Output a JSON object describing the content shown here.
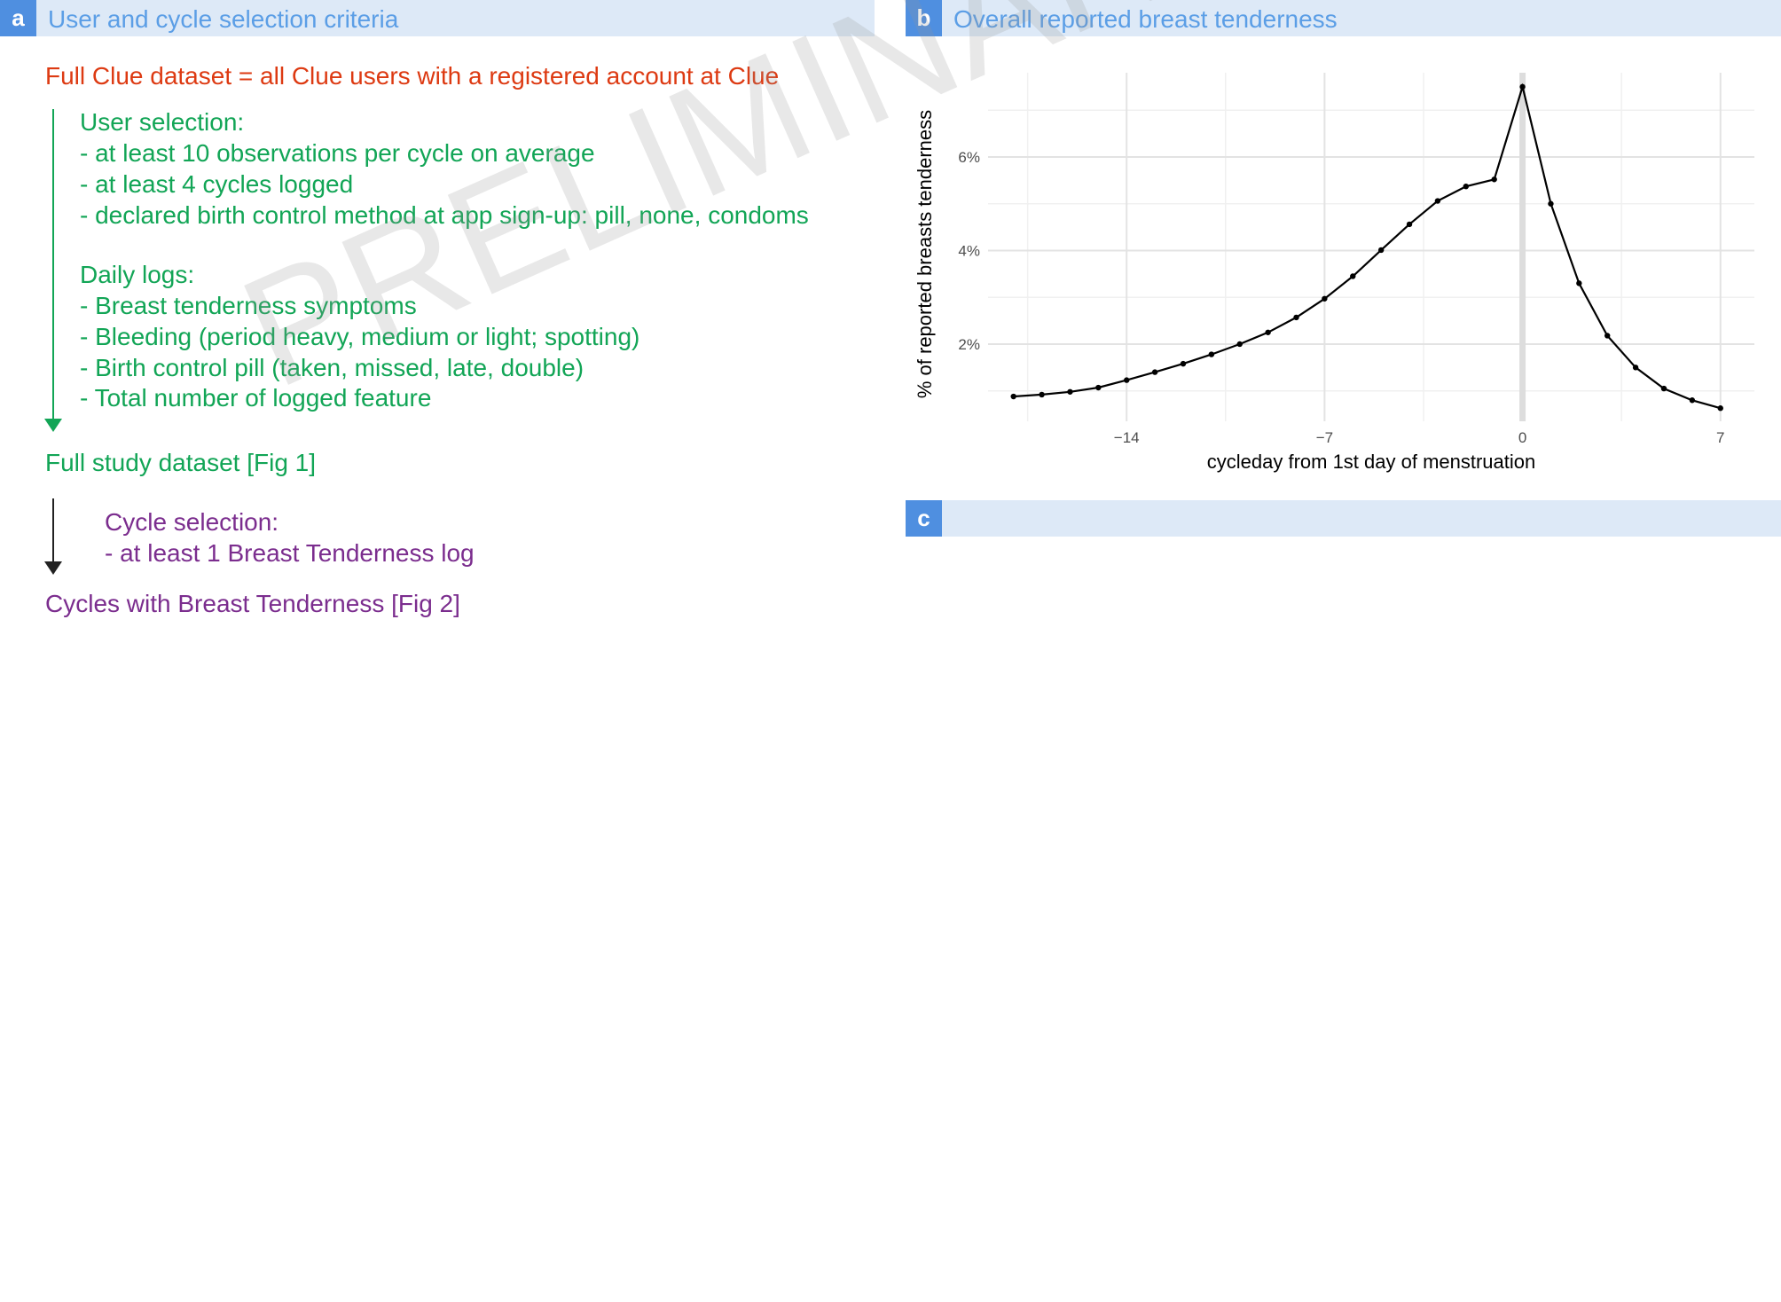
{
  "panel_a": {
    "letter": "a",
    "title": "User and cycle selection criteria",
    "full_dataset": "Full Clue dataset = all Clue users with a registered account at Clue",
    "user_selection_heading": "User selection:",
    "user_selection_items": [
      "- at least 10 observations per cycle on average",
      "- at least 4 cycles logged",
      "- declared birth control method at app sign-up: pill, none, condoms"
    ],
    "daily_logs_heading": "Daily logs:",
    "daily_logs_items": [
      "- Breast tenderness symptoms",
      "- Bleeding (period heavy, medium or light; spotting)",
      "- Birth control pill (taken, missed, late, double)",
      "- Total number of logged feature"
    ],
    "study_dataset": "Full study dataset [Fig 1]",
    "cycle_selection_heading": "Cycle selection:",
    "cycle_selection_item": "- at least 1 Breast Tenderness log",
    "cycles_result": "Cycles with Breast Tenderness [Fig 2]"
  },
  "panel_b": {
    "letter": "b",
    "title": "Overall reported breast tenderness"
  },
  "panel_c": {
    "letter": "c",
    "title": ""
  },
  "watermark": "PRELIMINARY",
  "colors": {
    "header_bg": "#dde9f7",
    "letter_bg": "#4f8fe0",
    "title_text": "#5b9ee6",
    "red": "#dd3a12",
    "green": "#12a556",
    "purple": "#7b2d8e"
  },
  "chart_data": {
    "type": "line",
    "title": "Overall reported breast tenderness",
    "xlabel": "cycleday from 1st day of menstruation",
    "ylabel": "% of reported breasts tenderness",
    "x_ticks": [
      -14,
      -7,
      0,
      7
    ],
    "x_tick_labels": [
      "−14",
      "−7",
      "0",
      "7"
    ],
    "y_ticks": [
      2,
      4,
      6
    ],
    "y_tick_labels": [
      "2%",
      "4%",
      "6%"
    ],
    "xlim": [
      -18.9,
      8.2
    ],
    "ylim": [
      0.35,
      7.8
    ],
    "grid": true,
    "vline_x": 0,
    "series": [
      {
        "x": [
          -18,
          -17,
          -16,
          -15,
          -14,
          -13,
          -12,
          -11,
          -10,
          -9,
          -8,
          -7,
          -6,
          -5,
          -4,
          -3,
          -2,
          -1,
          0,
          1,
          2,
          3,
          4,
          5,
          6,
          7
        ],
        "y": [
          0.88,
          0.92,
          0.98,
          1.07,
          1.23,
          1.4,
          1.58,
          1.78,
          2.0,
          2.25,
          2.57,
          2.97,
          3.45,
          4.01,
          4.56,
          5.06,
          5.37,
          5.52,
          7.5,
          5.0,
          3.3,
          2.18,
          1.5,
          1.05,
          0.8,
          0.63
        ]
      }
    ]
  }
}
